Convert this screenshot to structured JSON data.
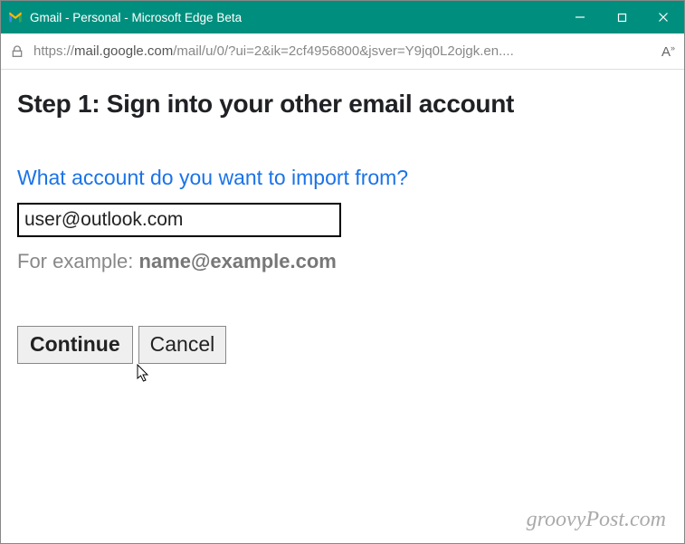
{
  "window": {
    "title": "Gmail - Personal - Microsoft Edge Beta"
  },
  "address": {
    "scheme": "https://",
    "host": "mail.google.com",
    "path": "/mail/u/0/?ui=2&ik=2cf4956800&jsver=Y9jq0L2ojgk.en...."
  },
  "content": {
    "heading": "Step 1: Sign into your other email account",
    "prompt": "What account do you want to import from?",
    "email_value": "user@outlook.com",
    "example_prefix": "For example: ",
    "example_value": "name@example.com",
    "continue_label": "Continue",
    "cancel_label": "Cancel"
  },
  "footer": {
    "watermark": "groovyPost.com"
  }
}
